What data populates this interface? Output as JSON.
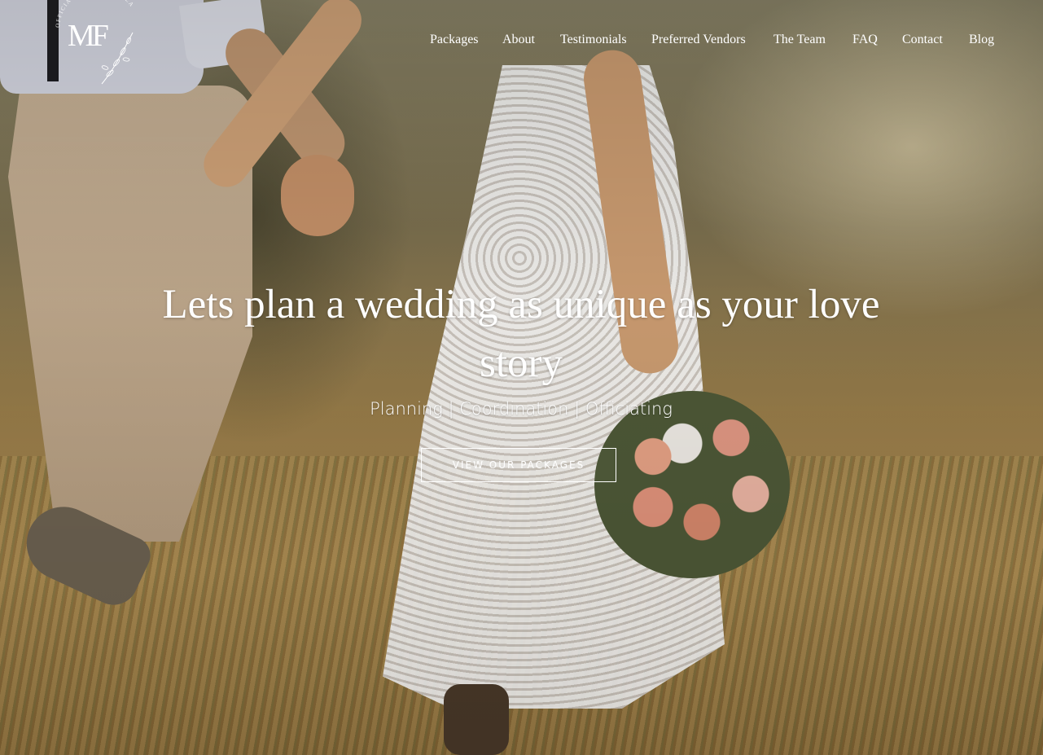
{
  "logo": {
    "monogram": "MF",
    "arc_text": "OFFICIATED BY MARIELLA"
  },
  "nav": {
    "items": [
      {
        "label": "Packages"
      },
      {
        "label": "About"
      },
      {
        "label": "Testimonials"
      },
      {
        "label": "Preferred Vendors"
      },
      {
        "label": "The Team"
      },
      {
        "label": "FAQ"
      },
      {
        "label": "Contact"
      },
      {
        "label": "Blog"
      }
    ]
  },
  "hero": {
    "headline": "Lets plan a wedding as unique as your love story",
    "subline": "Planning | Coordination | Officiating",
    "cta_label": "VIEW OUR PACKAGES",
    "background_description_icon": "wedding-couple-photo"
  },
  "colors": {
    "text": "#ffffff",
    "accent": "#ffffff"
  }
}
